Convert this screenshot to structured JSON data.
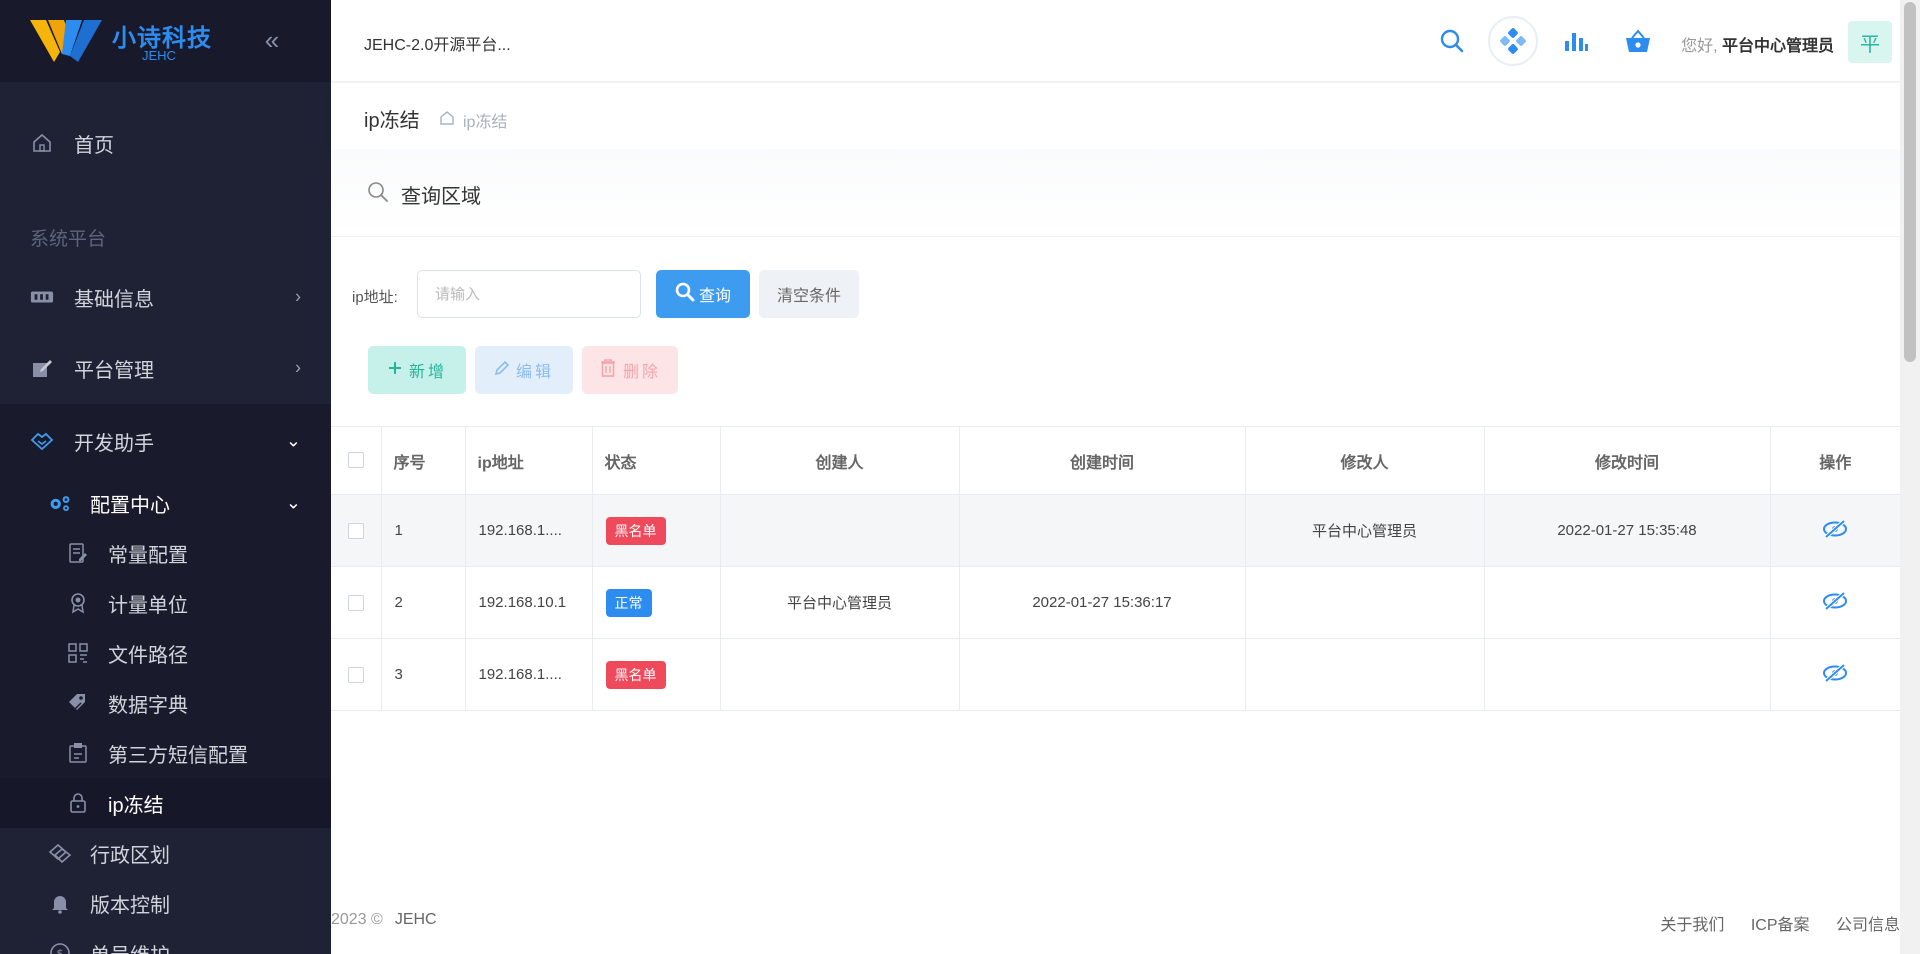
{
  "logo": {
    "name": "小诗科技",
    "sub": "JEHC"
  },
  "sidebar": {
    "home": "首页",
    "section": "系统平台",
    "items": [
      {
        "label": "基础信息"
      },
      {
        "label": "平台管理"
      },
      {
        "label": "开发助手"
      }
    ],
    "config_center": "配置中心",
    "config_children": [
      "常量配置",
      "计量单位",
      "文件路径",
      "数据字典",
      "第三方短信配置",
      "ip冻结"
    ],
    "more": [
      "行政区划",
      "版本控制",
      "单号维护"
    ]
  },
  "header": {
    "site_title": "JEHC-2.0开源平台...",
    "greeting_prefix": "您好,",
    "user_name": "平台中心管理员",
    "avatar_char": "平"
  },
  "breadcrumb": {
    "title": "ip冻结",
    "path": "ip冻结"
  },
  "query": {
    "panel_title": "查询区域",
    "ip_label": "ip地址:",
    "ip_placeholder": "请输入",
    "query_button": "查询",
    "clear_button": "清空条件"
  },
  "actions": {
    "add": "新增",
    "edit": "编辑",
    "delete": "删除"
  },
  "table": {
    "columns": [
      "序号",
      "ip地址",
      "状态",
      "创建人",
      "创建时间",
      "修改人",
      "修改时间",
      "操作"
    ],
    "rows": [
      {
        "no": "1",
        "ip": "192.168.1....",
        "status": "黑名单",
        "status_type": "black",
        "creator": "",
        "created": "",
        "modifier": "平台中心管理员",
        "modified": "2022-01-27 15:35:48"
      },
      {
        "no": "2",
        "ip": "192.168.10.1",
        "status": "正常",
        "status_type": "normal",
        "creator": "平台中心管理员",
        "created": "2022-01-27 15:36:17",
        "modifier": "",
        "modified": ""
      },
      {
        "no": "3",
        "ip": "192.168.1....",
        "status": "黑名单",
        "status_type": "black",
        "creator": "",
        "created": "",
        "modifier": "",
        "modified": ""
      }
    ]
  },
  "footer": {
    "copyright": "2023 ©",
    "brand": "JEHC",
    "links": [
      "关于我们",
      "ICP备案",
      "公司信息"
    ]
  },
  "colors": {
    "sidebar_bg": "#1f2235",
    "primary": "#3d9cf0",
    "blacklist": "#ef4a5c",
    "normal": "#2d8cf0",
    "add_text": "#27b49b"
  }
}
